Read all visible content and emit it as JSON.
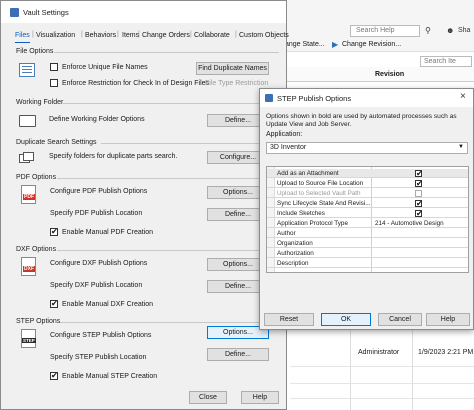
{
  "background": {
    "search_left": "Search Help",
    "search_right": "Search Ite",
    "toolbar_change_state": "ange State...",
    "toolbar_change_revision": "Change Revision...",
    "col_revision": "Revision",
    "row_user": "Administrator",
    "row_date": "1/9/2023 2:21 PM",
    "share_label": "Sha"
  },
  "vault_settings": {
    "title": "Vault Settings",
    "tabs": [
      "Files",
      "Visualization",
      "Behaviors",
      "Items",
      "Change Orders",
      "Collaborate",
      "Custom Objects"
    ],
    "file_options": {
      "header": "File Options",
      "enforce_unique": "Enforce Unique File Names",
      "find_duplicates": "Find Duplicate Names",
      "enforce_restriction": "Enforce Restriction for Check In of Design Files",
      "file_type_restriction": "File Type Restriction"
    },
    "working_folder": {
      "header": "Working Folder",
      "label": "Define Working Folder Options",
      "button": "Define..."
    },
    "duplicate_search": {
      "header": "Duplicate Search Settings",
      "label": "Specify folders for duplicate parts search.",
      "button": "Configure..."
    },
    "pdf": {
      "header": "PDF Options",
      "icon_text": "PDF",
      "configure_label": "Configure PDF Publish Options",
      "configure_button": "Options...",
      "location_label": "Specify PDF Publish Location",
      "location_button": "Define...",
      "manual_label": "Enable Manual PDF Creation"
    },
    "dxf": {
      "header": "DXF Options",
      "icon_text": "DXF",
      "configure_label": "Configure DXF Publish Options",
      "configure_button": "Options...",
      "location_label": "Specify DXF Publish Location",
      "location_button": "Define...",
      "manual_label": "Enable Manual DXF Creation"
    },
    "step": {
      "header": "STEP Options",
      "icon_text": "STEP",
      "configure_label": "Configure STEP Publish Options",
      "configure_button": "Options...",
      "location_label": "Specify STEP Publish Location",
      "location_button": "Define...",
      "manual_label": "Enable Manual STEP Creation"
    },
    "close_button": "Close",
    "help_button": "Help"
  },
  "step_dialog": {
    "title": "STEP Publish Options",
    "description": "Options shown in bold are used by automated processes such as Update View and Job Server.",
    "application_label": "Application:",
    "application_value": "3D Inventor",
    "rows": [
      {
        "label": "Add as an Attachment",
        "value": "",
        "checked": true
      },
      {
        "label": "Upload to Source File Location",
        "value": "",
        "checked": true
      },
      {
        "label": "Upload to Selected Vault Path",
        "value": "",
        "checked": false
      },
      {
        "label": "Sync Lifecycle State And Revisi...",
        "value": "",
        "checked": true
      },
      {
        "label": "Include Sketches",
        "value": "",
        "checked": true
      },
      {
        "label": "Application Protocol Type",
        "value": "214 - Automotive Design",
        "checked": null
      },
      {
        "label": "Author",
        "value": "",
        "checked": null
      },
      {
        "label": "Organization",
        "value": "",
        "checked": null
      },
      {
        "label": "Authorization",
        "value": "",
        "checked": null
      },
      {
        "label": "Description",
        "value": "",
        "checked": null
      }
    ],
    "reset_button": "Reset",
    "ok_button": "OK",
    "cancel_button": "Cancel",
    "help_button": "Help"
  }
}
